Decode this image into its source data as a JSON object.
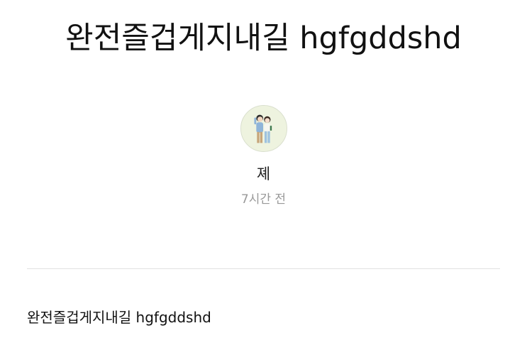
{
  "post": {
    "title": "완전즐겁게지내길 hgfgddshd",
    "author": {
      "name": "졔",
      "avatar_icon": "couple-illustration-avatar"
    },
    "time": "7시간 전",
    "body": "완전즐겁게지내길 hgfgddshd"
  },
  "colors": {
    "text": "#111111",
    "muted": "#999999",
    "divider": "#e1e1e1",
    "avatar_bg": "#eef3df"
  }
}
